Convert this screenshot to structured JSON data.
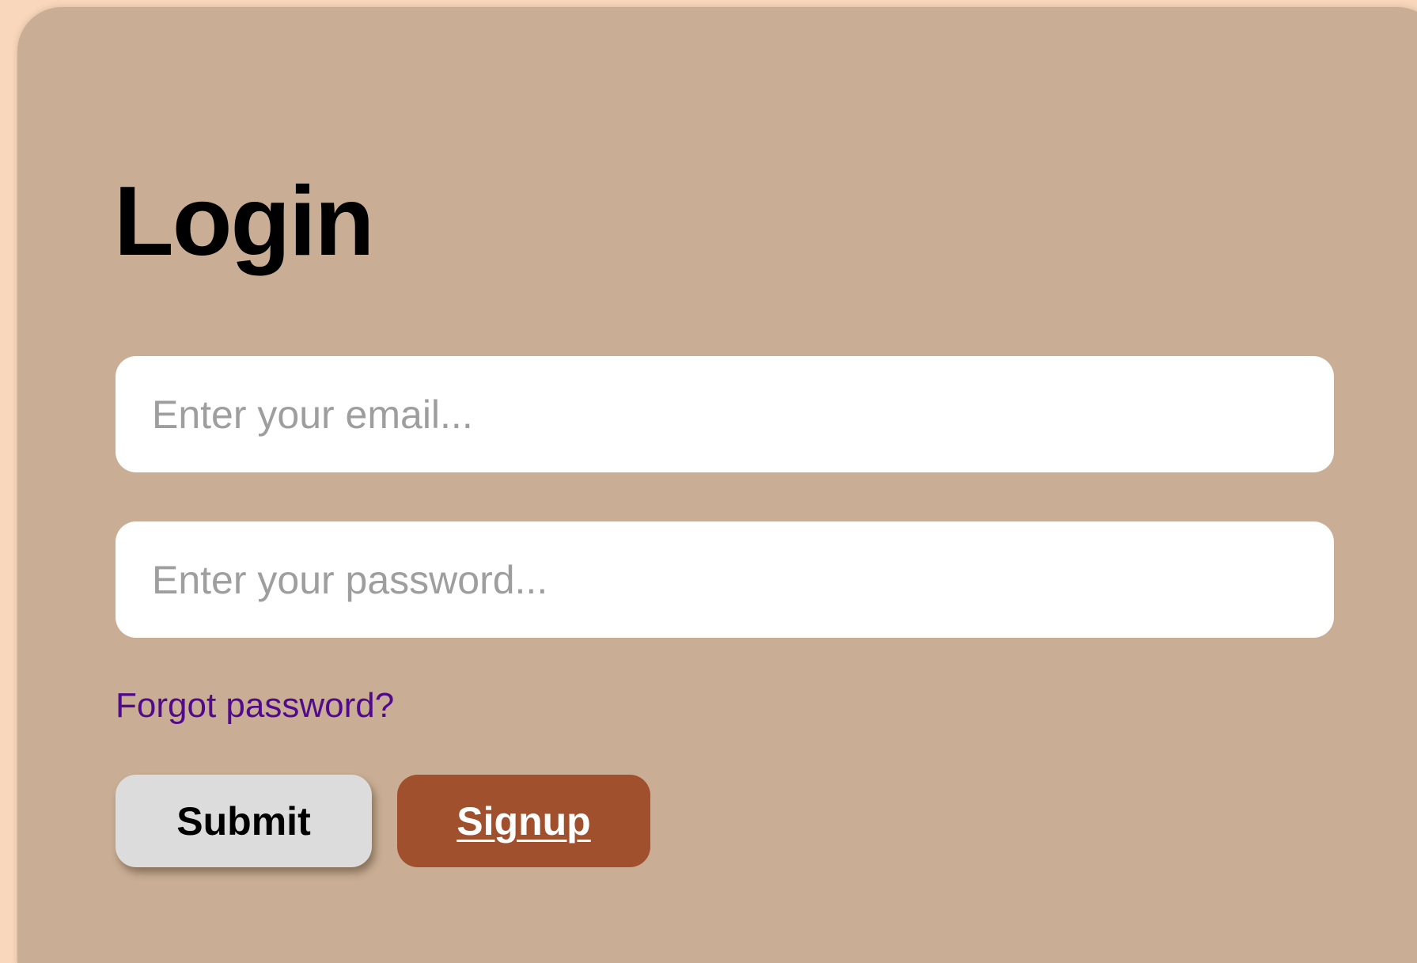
{
  "form": {
    "title": "Login",
    "email": {
      "value": "",
      "placeholder": "Enter your email..."
    },
    "password": {
      "value": "",
      "placeholder": "Enter your password..."
    },
    "forgot_label": "Forgot password?",
    "submit_label": "Submit",
    "signup_label": "Signup"
  },
  "colors": {
    "background": "#f8d7bd",
    "card": "#c9ae95",
    "field": "#ffffff",
    "placeholder": "#9e9e9e",
    "link": "#520a8d",
    "submit_bg": "#dcdcdc",
    "signup_bg": "#a0502d"
  }
}
